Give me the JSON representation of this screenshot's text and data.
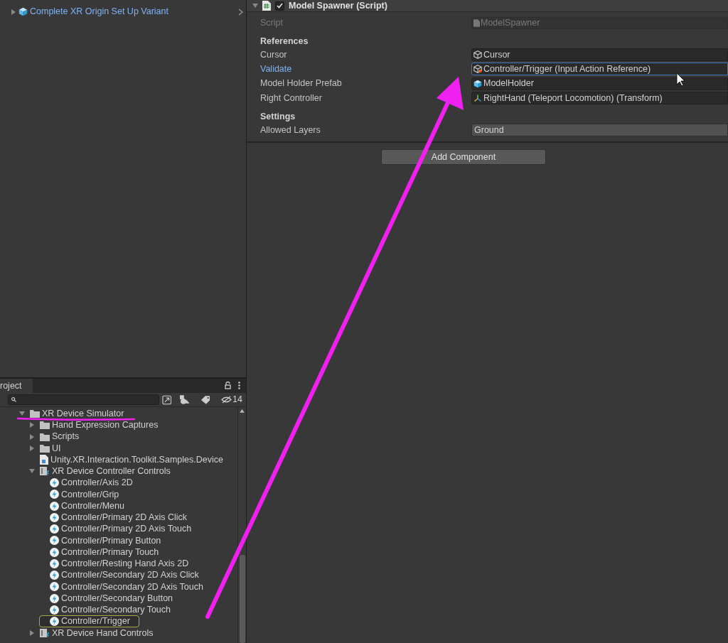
{
  "hierarchy": {
    "items": [
      {
        "label": "Complete XR Origin Set Up Variant",
        "expanded": false
      }
    ]
  },
  "inspector": {
    "component": {
      "title": "Model Spawner (Script)",
      "enabled": true,
      "expanded": true
    },
    "script_field": {
      "label": "Script",
      "value": "ModelSpawner",
      "disabled": true
    },
    "sections": [
      {
        "title": "References",
        "fields": [
          {
            "label": "Cursor",
            "value": "Cursor",
            "kind": "object",
            "focused": false
          },
          {
            "label": "Validate",
            "value": "Controller/Trigger (Input Action Reference)",
            "kind": "action-reference",
            "focused": true
          },
          {
            "label": "Model Holder Prefab",
            "value": "ModelHolder",
            "kind": "prefab",
            "focused": false
          },
          {
            "label": "Right Controller",
            "value": "RightHand (Teleport Locomotion) (Transform)",
            "kind": "transform",
            "focused": false
          }
        ]
      },
      {
        "title": "Settings",
        "fields": [
          {
            "label": "Allowed Layers",
            "value": "Ground",
            "kind": "dropdown",
            "focused": false
          }
        ]
      }
    ],
    "add_component_button": "Add Component"
  },
  "project": {
    "tab": "roject",
    "hidden_count": "14",
    "tree": [
      {
        "label": "XR Device Simulator",
        "kind": "folder",
        "expanded": true,
        "selected": false,
        "children": [
          {
            "label": "Hand Expression Captures",
            "kind": "folder",
            "expanded": false,
            "selected": false
          },
          {
            "label": "Scripts",
            "kind": "folder",
            "expanded": false,
            "selected": false
          },
          {
            "label": "UI",
            "kind": "folder",
            "expanded": false,
            "selected": false
          },
          {
            "label": "Unity.XR.Interaction.Toolkit.Samples.Device",
            "kind": "assembly",
            "selected": false
          },
          {
            "label": "XR Device Controller Controls",
            "kind": "actions",
            "expanded": true,
            "selected": false,
            "children": [
              {
                "label": "Controller/Axis 2D",
                "kind": "action",
                "selected": false
              },
              {
                "label": "Controller/Grip",
                "kind": "action",
                "selected": false
              },
              {
                "label": "Controller/Menu",
                "kind": "action",
                "selected": false
              },
              {
                "label": "Controller/Primary 2D Axis Click",
                "kind": "action",
                "selected": false
              },
              {
                "label": "Controller/Primary 2D Axis Touch",
                "kind": "action",
                "selected": false
              },
              {
                "label": "Controller/Primary Button",
                "kind": "action",
                "selected": false
              },
              {
                "label": "Controller/Primary Touch",
                "kind": "action",
                "selected": false
              },
              {
                "label": "Controller/Resting Hand Axis 2D",
                "kind": "action",
                "selected": false
              },
              {
                "label": "Controller/Secondary 2D Axis Click",
                "kind": "action",
                "selected": false
              },
              {
                "label": "Controller/Secondary 2D Axis Touch",
                "kind": "action",
                "selected": false
              },
              {
                "label": "Controller/Secondary Button",
                "kind": "action",
                "selected": false
              },
              {
                "label": "Controller/Secondary Touch",
                "kind": "action",
                "selected": false
              },
              {
                "label": "Controller/Trigger",
                "kind": "action",
                "selected": true
              }
            ]
          },
          {
            "label": "XR Device Hand Controls",
            "kind": "actions",
            "expanded": false,
            "selected": false
          }
        ]
      }
    ]
  }
}
